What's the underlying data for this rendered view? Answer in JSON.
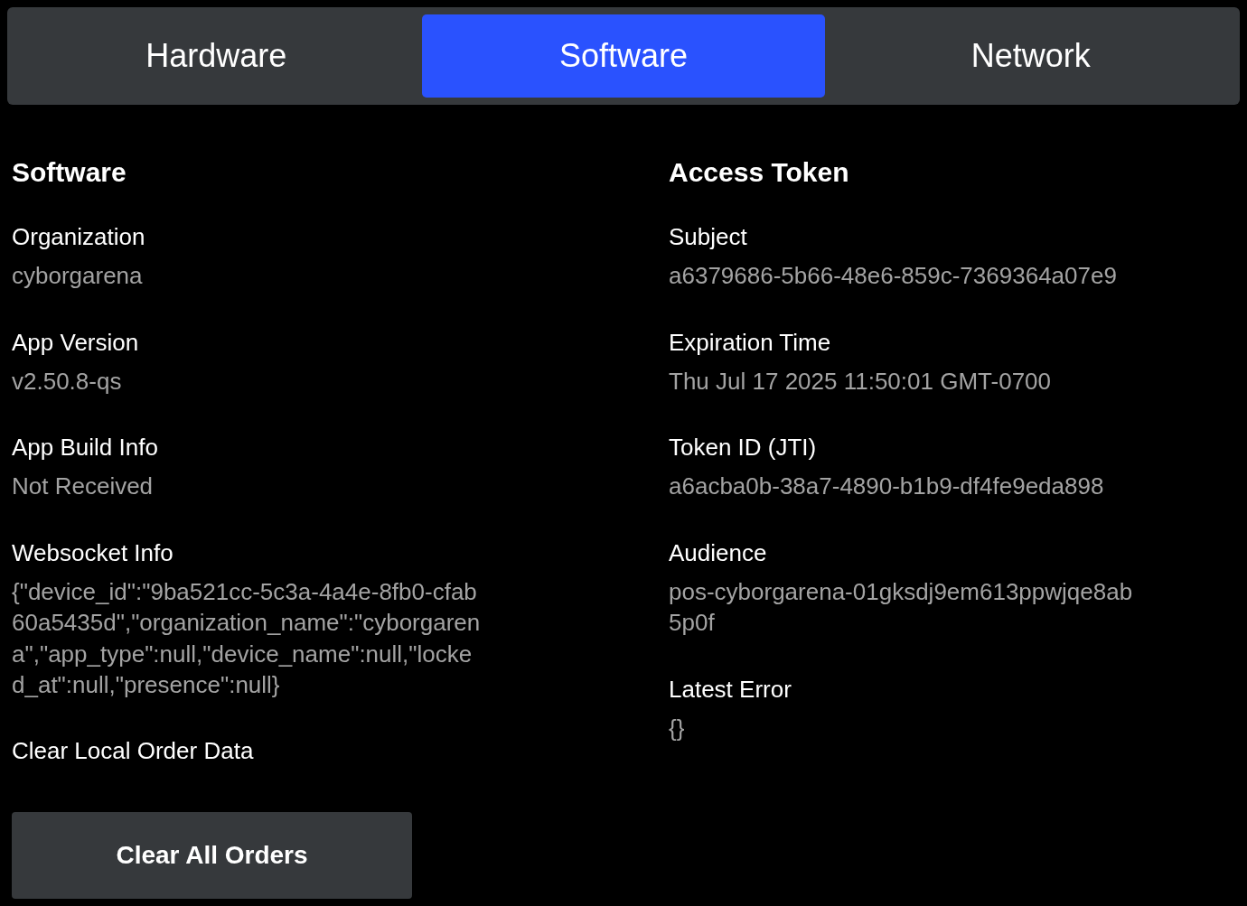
{
  "tabs": [
    {
      "label": "Hardware",
      "selected": false
    },
    {
      "label": "Software",
      "selected": true
    },
    {
      "label": "Network",
      "selected": false
    }
  ],
  "sections": [
    {
      "title": "Software",
      "fields": [
        {
          "label": "Organization",
          "value": "cyborgarena"
        },
        {
          "label": "App Version",
          "value": "v2.50.8-qs"
        },
        {
          "label": "App Build Info",
          "value": "Not Received"
        },
        {
          "label": "Websocket Info",
          "value": "{\"device_id\":\"9ba521cc-5c3a-4a4e-8fb0-cfab60a5435d\",\"organization_name\":\"cyborgarena\",\"app_type\":null,\"device_name\":null,\"locked_at\":null,\"presence\":null}"
        }
      ],
      "action": {
        "label": "Clear Local Order Data",
        "button": "Clear All Orders"
      }
    },
    {
      "title": "Access Token",
      "fields": [
        {
          "label": "Subject",
          "value": "a6379686-5b66-48e6-859c-7369364a07e9"
        },
        {
          "label": "Expiration Time",
          "value": "Thu Jul 17 2025 11:50:01 GMT-0700"
        },
        {
          "label": "Token ID (JTI)",
          "value": "a6acba0b-38a7-4890-b1b9-df4fe9eda898"
        },
        {
          "label": "Audience",
          "value": "pos-cyborgarena-01gksdj9em613ppwjqe8ab5p0f"
        },
        {
          "label": "Latest Error",
          "value": "{}"
        }
      ]
    }
  ]
}
